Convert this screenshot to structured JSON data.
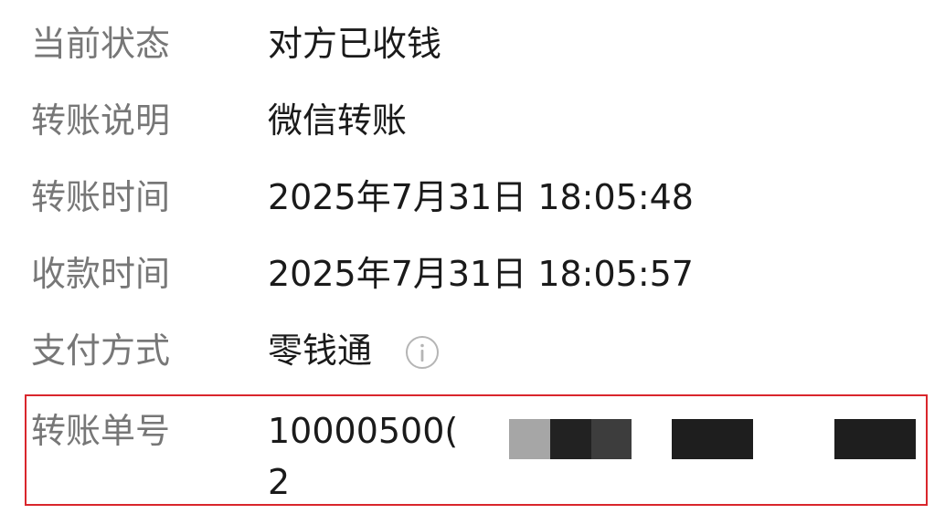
{
  "rows": [
    {
      "label": "当前状态",
      "value": "对方已收钱"
    },
    {
      "label": "转账说明",
      "value": "微信转账"
    },
    {
      "label": "转账时间",
      "value": "2025年7月31日 18:05:48"
    },
    {
      "label": "收款时间",
      "value": "2025年7月31日 18:05:57"
    },
    {
      "label": "支付方式",
      "value": "零钱通"
    }
  ],
  "payment_info_icon": "info-icon",
  "order": {
    "label": "转账单号",
    "value_line1": "10000500(",
    "value_line2": "2",
    "redacted_segments": [
      {
        "color": "#a6a6a6"
      },
      {
        "color": "#222222"
      },
      {
        "color": "#3d3d3d"
      },
      {
        "color": "#1e1e1e"
      },
      {
        "color": "#1e1e1e"
      }
    ]
  },
  "colors": {
    "label": "#777777",
    "value": "#1a1a1a",
    "highlight_border": "#d9262c",
    "background": "#ffffff"
  }
}
